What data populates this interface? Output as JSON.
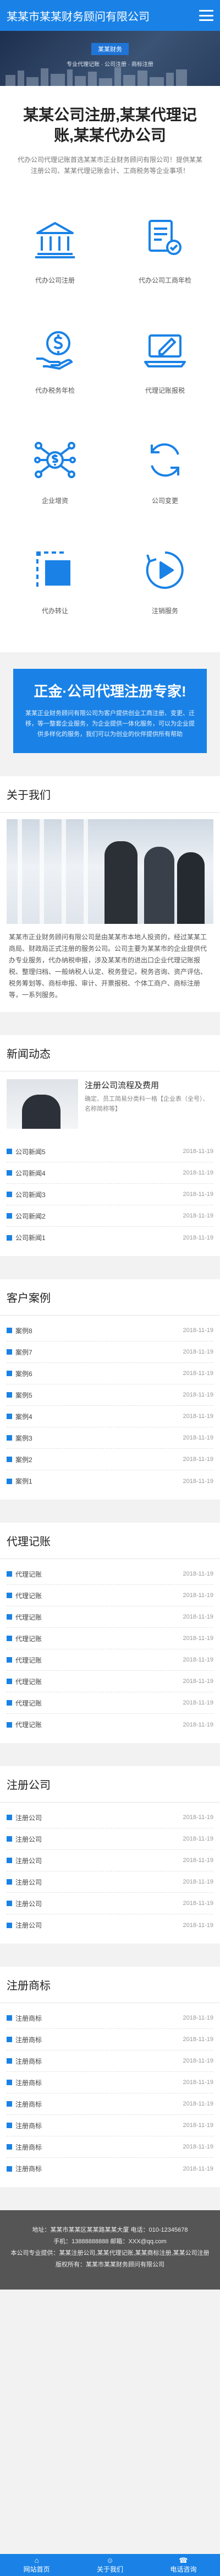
{
  "header": {
    "logo": "某某市某某财务顾问有限公司"
  },
  "banner": {
    "tag": "某某财务",
    "sub": "专业代理记账 · 公司注册 · 商标注册"
  },
  "intro": {
    "title": "某某公司注册,某某代理记账,某某代办公司",
    "text": "代办公司代理记账首选某某市正业财务顾问有限公司！提供某某注册公司、某某代理记账会计、工商税务等企业事项！"
  },
  "services": [
    {
      "label": "代办公司注册",
      "icon": "bank-icon"
    },
    {
      "label": "代办公司工商年检",
      "icon": "document-stamp-icon"
    },
    {
      "label": "代办税务年检",
      "icon": "dollar-hand-icon"
    },
    {
      "label": "代理记账报税",
      "icon": "laptop-pencil-icon"
    },
    {
      "label": "企业增资",
      "icon": "network-dollar-icon"
    },
    {
      "label": "公司变更",
      "icon": "refresh-icon"
    },
    {
      "label": "代办转让",
      "icon": "selection-box-icon"
    },
    {
      "label": "注销服务",
      "icon": "play-cycle-icon"
    }
  ],
  "cta": {
    "title": "正金·公司代理注册专家!",
    "text": "某某正业财务顾问有限公司为客户提供创业工商注册、变更、迁移，等一整套企业服务，为企业提供一体化服务，可以为企业提供多样化的服务，我们可以为创业的伙伴提供所有帮助"
  },
  "about": {
    "title": "关于我们",
    "text": "某某市正业财务顾问有限公司是由某某市本地人投资的，经过某某工商局、财政局正式注册的服务公司。公司主要为某某市的企业提供代办专业服务，代办纳税申报，涉及某某市的进出口企业代理记账报税、整理归档、一般纳税人认定、税务登记，税务咨询、资产评估、税务筹划等、商标申报、审计、开票报税、个体工商户、商标注册等，一系列服务。"
  },
  "news": {
    "title": "新闻动态",
    "featured": {
      "title": "注册公司流程及费用",
      "summary": "确定、员工简易分类科一格【企业表（全号）、名称简称等】"
    },
    "items": [
      {
        "title": "公司新闻5",
        "date": "2018-11-19"
      },
      {
        "title": "公司新闻4",
        "date": "2018-11-19"
      },
      {
        "title": "公司新闻3",
        "date": "2018-11-19"
      },
      {
        "title": "公司新闻2",
        "date": "2018-11-19"
      },
      {
        "title": "公司新闻1",
        "date": "2018-11-19"
      }
    ]
  },
  "cases": {
    "title": "客户案例",
    "items": [
      {
        "title": "案例8",
        "date": "2018-11-19"
      },
      {
        "title": "案例7",
        "date": "2018-11-19"
      },
      {
        "title": "案例6",
        "date": "2018-11-19"
      },
      {
        "title": "案例5",
        "date": "2018-11-19"
      },
      {
        "title": "案例4",
        "date": "2018-11-19"
      },
      {
        "title": "案例3",
        "date": "2018-11-19"
      },
      {
        "title": "案例2",
        "date": "2018-11-19"
      },
      {
        "title": "案例1",
        "date": "2018-11-19"
      }
    ]
  },
  "bookkeeping": {
    "title": "代理记账",
    "items": [
      {
        "title": "代理记账",
        "date": "2018-11-19"
      },
      {
        "title": "代理记账",
        "date": "2018-11-19"
      },
      {
        "title": "代理记账",
        "date": "2018-11-19"
      },
      {
        "title": "代理记账",
        "date": "2018-11-19"
      },
      {
        "title": "代理记账",
        "date": "2018-11-19"
      },
      {
        "title": "代理记账",
        "date": "2018-11-19"
      },
      {
        "title": "代理记账",
        "date": "2018-11-19"
      },
      {
        "title": "代理记账",
        "date": "2018-11-19"
      }
    ]
  },
  "registration": {
    "title": "注册公司",
    "items": [
      {
        "title": "注册公司",
        "date": "2018-11-19"
      },
      {
        "title": "注册公司",
        "date": "2018-11-19"
      },
      {
        "title": "注册公司",
        "date": "2018-11-19"
      },
      {
        "title": "注册公司",
        "date": "2018-11-19"
      },
      {
        "title": "注册公司",
        "date": "2018-11-19"
      },
      {
        "title": "注册公司",
        "date": "2018-11-19"
      }
    ]
  },
  "trademark": {
    "title": "注册商标",
    "items": [
      {
        "title": "注册商标",
        "date": "2018-11-19"
      },
      {
        "title": "注册商标",
        "date": "2018-11-19"
      },
      {
        "title": "注册商标",
        "date": "2018-11-19"
      },
      {
        "title": "注册商标",
        "date": "2018-11-19"
      },
      {
        "title": "注册商标",
        "date": "2018-11-19"
      },
      {
        "title": "注册商标",
        "date": "2018-11-19"
      },
      {
        "title": "注册商标",
        "date": "2018-11-19"
      },
      {
        "title": "注册商标",
        "date": "2018-11-19"
      }
    ]
  },
  "footer": {
    "line1": "地址：某某市某某区某某路某某大厦  电话：010-12345678",
    "line2": "手机：13888888888  邮箱：XXX@qq.com",
    "line3": "本公司专业提供：某某注册公司,某某代理记账,某某商标注册,某某公司注册",
    "line4": "版权所有：某某市某某财务顾问有限公司"
  },
  "tabbar": [
    {
      "label": "网站首页",
      "icon": "home-icon"
    },
    {
      "label": "关于我们",
      "icon": "user-icon"
    },
    {
      "label": "电话咨询",
      "icon": "phone-icon"
    }
  ]
}
